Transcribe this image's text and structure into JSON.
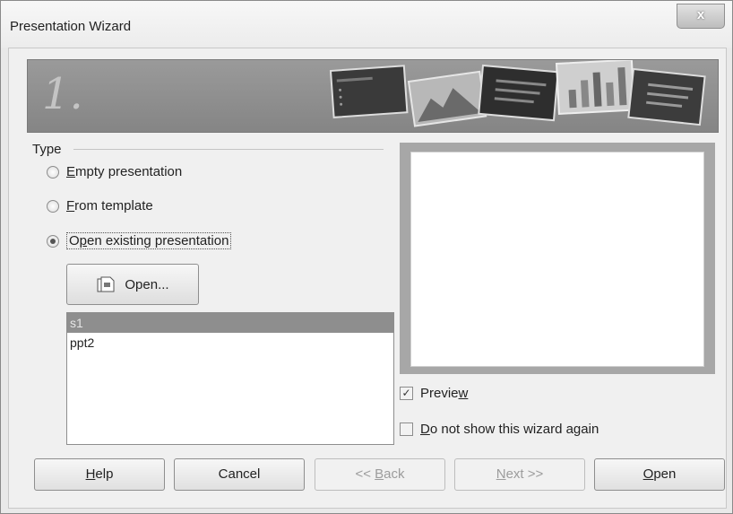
{
  "window": {
    "title": "Presentation Wizard",
    "close": "x"
  },
  "banner": {
    "step": "1."
  },
  "type_section": {
    "label": "Type",
    "options": [
      {
        "pre": "",
        "key": "E",
        "rest": "mpty presentation",
        "checked": false
      },
      {
        "pre": "",
        "key": "F",
        "rest": "rom template",
        "checked": false
      },
      {
        "pre": "O",
        "key": "p",
        "rest": "en existing presentation",
        "checked": true
      }
    ],
    "open_button": "Open..."
  },
  "file_list": {
    "items": [
      "s1",
      "ppt2"
    ],
    "selected": 0
  },
  "preview_option": {
    "pre": "Previe",
    "key": "w",
    "rest": "",
    "checked": true
  },
  "no_show_option": {
    "pre": "",
    "key": "D",
    "rest": "o not show this wizard again",
    "checked": false
  },
  "footer": {
    "help": {
      "pre": "",
      "key": "H",
      "rest": "elp"
    },
    "cancel": "Cancel",
    "back": {
      "pre": "<< ",
      "key": "B",
      "rest": "ack"
    },
    "next": {
      "pre": "",
      "key": "N",
      "rest": "ext >>"
    },
    "open": {
      "pre": "",
      "key": "O",
      "rest": "pen"
    }
  }
}
